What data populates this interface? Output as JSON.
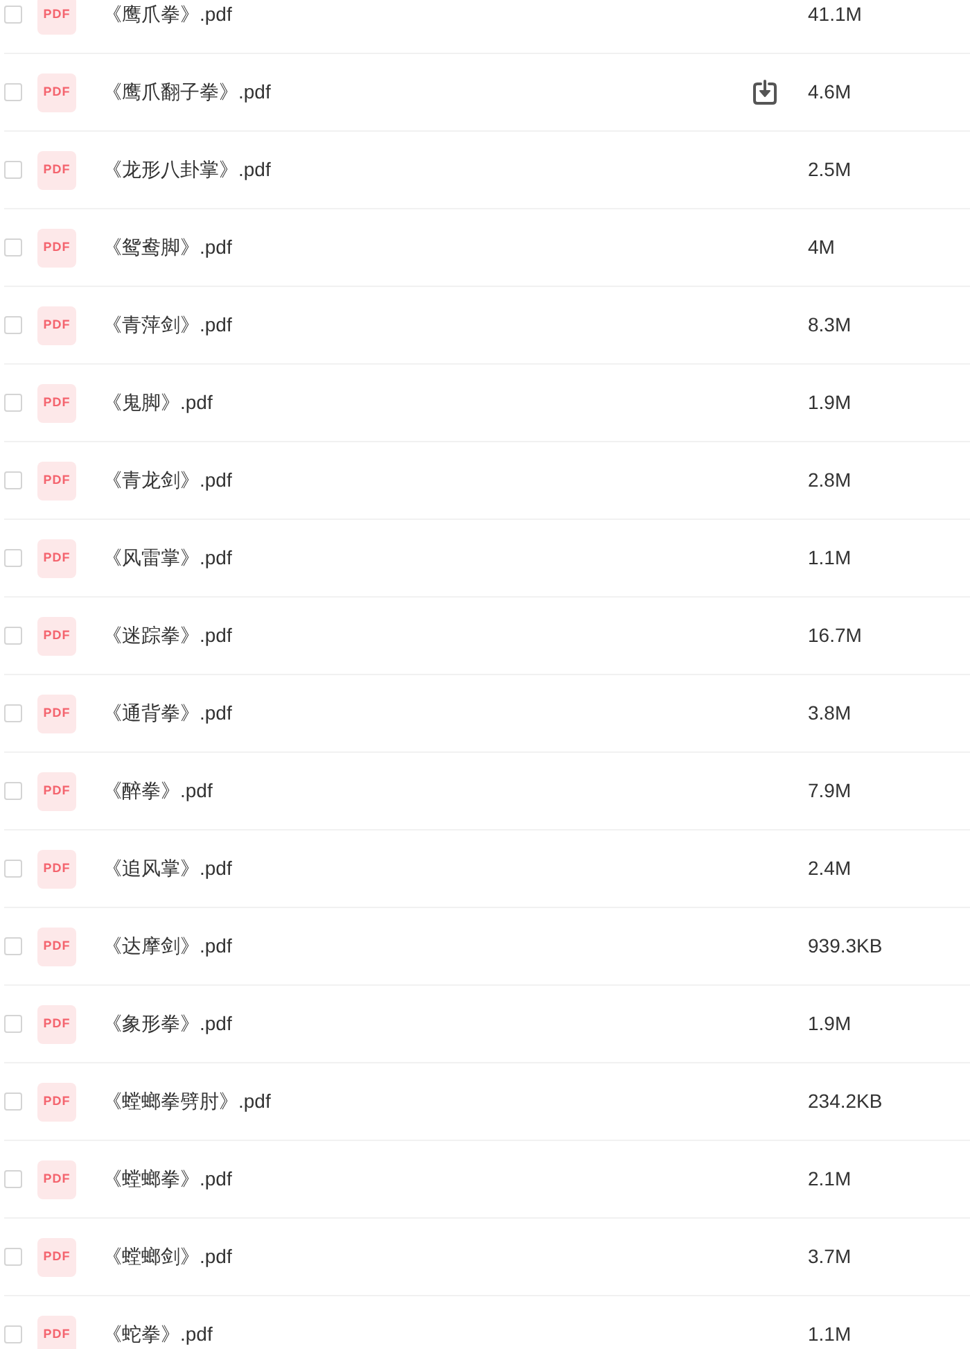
{
  "files": [
    {
      "name": "《鹰爪拳》.pdf",
      "badge": "PDF",
      "size": "41.1M",
      "checked": false,
      "hovered": false
    },
    {
      "name": "《鹰爪翻子拳》.pdf",
      "badge": "PDF",
      "size": "4.6M",
      "checked": false,
      "hovered": true
    },
    {
      "name": "《龙形八卦掌》.pdf",
      "badge": "PDF",
      "size": "2.5M",
      "checked": false,
      "hovered": false
    },
    {
      "name": "《鸳鸯脚》.pdf",
      "badge": "PDF",
      "size": "4M",
      "checked": false,
      "hovered": false
    },
    {
      "name": "《青萍剑》.pdf",
      "badge": "PDF",
      "size": "8.3M",
      "checked": false,
      "hovered": false
    },
    {
      "name": "《鬼脚》.pdf",
      "badge": "PDF",
      "size": "1.9M",
      "checked": false,
      "hovered": false
    },
    {
      "name": "《青龙剑》.pdf",
      "badge": "PDF",
      "size": "2.8M",
      "checked": false,
      "hovered": false
    },
    {
      "name": "《风雷掌》.pdf",
      "badge": "PDF",
      "size": "1.1M",
      "checked": false,
      "hovered": false
    },
    {
      "name": "《迷踪拳》.pdf",
      "badge": "PDF",
      "size": "16.7M",
      "checked": false,
      "hovered": false
    },
    {
      "name": "《通背拳》.pdf",
      "badge": "PDF",
      "size": "3.8M",
      "checked": false,
      "hovered": false
    },
    {
      "name": "《醉拳》.pdf",
      "badge": "PDF",
      "size": "7.9M",
      "checked": false,
      "hovered": false
    },
    {
      "name": "《追风掌》.pdf",
      "badge": "PDF",
      "size": "2.4M",
      "checked": false,
      "hovered": false
    },
    {
      "name": "《达摩剑》.pdf",
      "badge": "PDF",
      "size": "939.3KB",
      "checked": false,
      "hovered": false
    },
    {
      "name": "《象形拳》.pdf",
      "badge": "PDF",
      "size": "1.9M",
      "checked": false,
      "hovered": false
    },
    {
      "name": "《螳螂拳劈肘》.pdf",
      "badge": "PDF",
      "size": "234.2KB",
      "checked": false,
      "hovered": false
    },
    {
      "name": "《螳螂拳》.pdf",
      "badge": "PDF",
      "size": "2.1M",
      "checked": false,
      "hovered": false
    },
    {
      "name": "《螳螂剑》.pdf",
      "badge": "PDF",
      "size": "3.7M",
      "checked": false,
      "hovered": false
    },
    {
      "name": "《蛇拳》.pdf",
      "badge": "PDF",
      "size": "1.1M",
      "checked": false,
      "hovered": false
    }
  ]
}
